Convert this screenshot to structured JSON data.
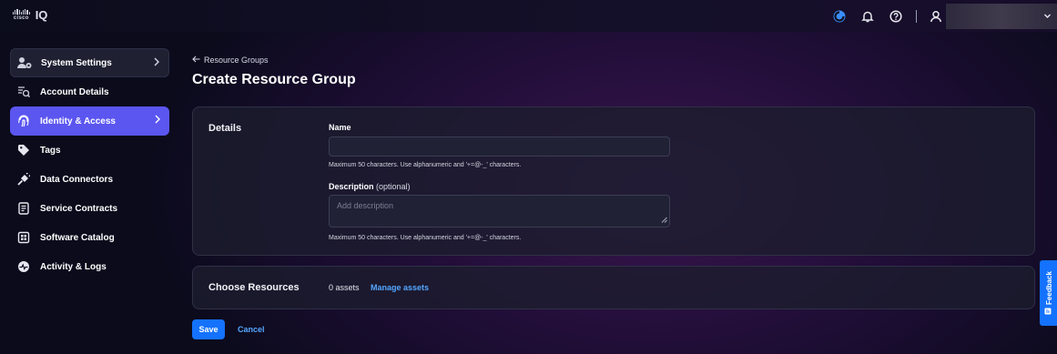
{
  "header": {
    "logo_word": "cisco",
    "product": "IQ"
  },
  "sidebar": {
    "items": [
      {
        "label": "System Settings",
        "icon": "system-settings-icon",
        "state": "parent"
      },
      {
        "label": "Account Details",
        "icon": "account-details-icon"
      },
      {
        "label": "Identity & Access",
        "icon": "fingerprint-icon",
        "state": "active"
      },
      {
        "label": "Tags",
        "icon": "tag-icon"
      },
      {
        "label": "Data Connectors",
        "icon": "plug-icon"
      },
      {
        "label": "Service Contracts",
        "icon": "contract-icon"
      },
      {
        "label": "Software Catalog",
        "icon": "catalog-icon"
      },
      {
        "label": "Activity & Logs",
        "icon": "activity-icon"
      }
    ]
  },
  "main": {
    "back_link": "Resource Groups",
    "title": "Create Resource Group",
    "details": {
      "section_label": "Details",
      "name_label": "Name",
      "name_value": "",
      "name_hint": "Maximum 50 characters. Use alphanumeric and '+=@-_' characters.",
      "desc_label": "Description",
      "desc_optional": "(optional)",
      "desc_placeholder": "Add description",
      "desc_hint": "Maximum 50 characters. Use alphanumeric and '+=@-_' characters."
    },
    "resources": {
      "section_label": "Choose Resources",
      "asset_count": "0 assets",
      "manage_link": "Manage assets"
    },
    "actions": {
      "save": "Save",
      "cancel": "Cancel"
    }
  },
  "feedback": {
    "label": "Feedback"
  },
  "colors": {
    "accent": "#1472ff",
    "active_nav": "#5b56f0",
    "link": "#54a7ff"
  }
}
